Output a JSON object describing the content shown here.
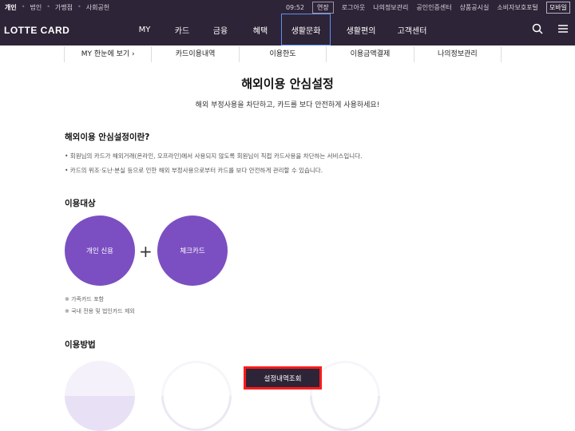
{
  "topbar": {
    "links": [
      "개인",
      "법인",
      "가맹점",
      "사회공헌"
    ],
    "time": "09:52",
    "extend": "연장",
    "logout": "로그아웃",
    "utils": [
      "나의정보관리",
      "공인인증센터",
      "상품공시실",
      "소비자보호포털"
    ],
    "mobile": "모바일"
  },
  "nav": {
    "logo": "LOTTE CARD",
    "menu": [
      "MY",
      "카드",
      "금융",
      "혜택",
      "생활문화",
      "생활편의",
      "고객센터"
    ]
  },
  "subnav": [
    "MY 한눈에 보기  ›",
    "카드이용내역",
    "이용한도",
    "이용금액결제",
    "나의정보관리"
  ],
  "page": {
    "title": "해외이용 안심설정",
    "subtitle": "해외 부정사용을 차단하고, 카드를 보다 안전하게 사용하세요!",
    "section1": {
      "heading": "해외이용 안심설정이란?",
      "bullets": [
        "•  회원님의 카드가 해외거래(온라인, 오프라인)에서 사용되지 않도록 회원님이 직접 카드사용을 차단하는 서비스입니다.",
        "•  카드의 위조·도난·분실 등으로 인한 해외 부정사용으로부터 카드를 보다 안전하게 관리할 수 있습니다."
      ]
    },
    "section2": {
      "heading": "이용대상",
      "circle1": "개인 신용",
      "plus": "+",
      "circle2": "체크카드",
      "notes": [
        "※ 가족카드 포함",
        "※ 국내 전용 및 법인카드 제외"
      ]
    },
    "section3": {
      "heading": "이용방법"
    },
    "bottom_button": "설정내역조회",
    "colors": {
      "brand": "#2e2437",
      "accent": "#7b4fc1",
      "highlight": "#ff1a1a"
    }
  }
}
